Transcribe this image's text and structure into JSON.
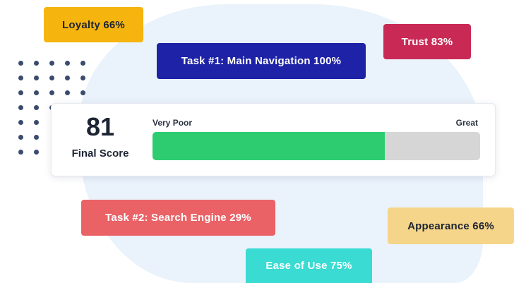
{
  "score": {
    "value": "81",
    "label": "Final Score",
    "scale_low": "Very Poor",
    "scale_high": "Great",
    "fill_fraction": 0.71,
    "fill_color": "#2ecc71",
    "track_color": "#d6d6d6"
  },
  "tags": {
    "loyalty": {
      "text": "Loyalty 66%",
      "bg": "#f6b40e",
      "fg": "#1d2433"
    },
    "task1": {
      "text": "Task #1: Main Navigation 100%",
      "bg": "#1e22a6",
      "fg": "#ffffff"
    },
    "trust": {
      "text": "Trust 83%",
      "bg": "#c92a55",
      "fg": "#ffffff"
    },
    "task2": {
      "text": "Task #2: Search Engine 29%",
      "bg": "#ea6266",
      "fg": "#ffffff"
    },
    "appearance": {
      "text": "Appearance 66%",
      "bg": "#f5d589",
      "fg": "#1d2433"
    },
    "ease": {
      "text": "Ease of Use 75%",
      "bg": "#39dbd2",
      "fg": "#ffffff"
    }
  }
}
